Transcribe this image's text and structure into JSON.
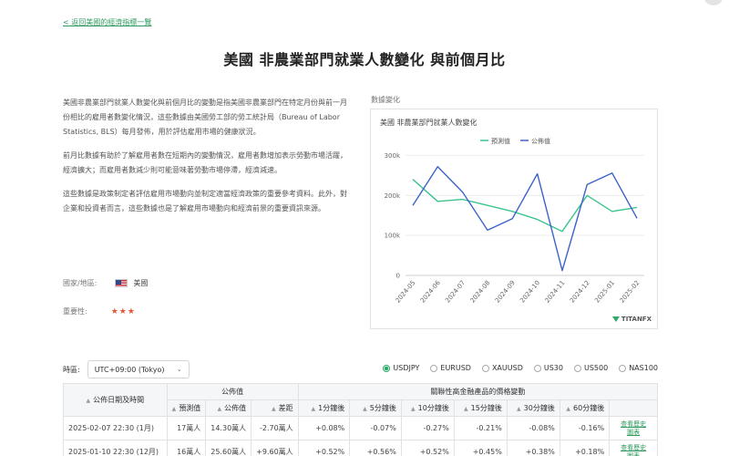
{
  "nav": {
    "back_link": "< 返回美國的經濟指標一覽"
  },
  "page": {
    "title": "美國 非農業部門就業人數變化 與前個月比"
  },
  "description": {
    "paragraphs": [
      "美國非農業部門就業人數變化與前個月比的變動是指美國非農業部門在特定月份與前一月份相比的雇用者數變化情況，這些數據由美國勞工部的勞工統計局（Bureau of Labor Statistics, BLS）每月發佈，用於評估雇用市場的健康狀況。",
      "前月比數據有助於了解雇用者數在短期內的變動情況，雇用者數增加表示勞動市場活躍，經濟擴大；而雇用者數減少則可能意味著勞動市場停滯，經濟減速。",
      "這些數據是政策制定者評估雇用市場動向並制定適當經濟政策的重要參考資料。此外，對企業和投資者而言，這些數據也是了解雇用市場動向和經濟前景的重要資訊來源。"
    ]
  },
  "meta": {
    "country_label": "國家/地區:",
    "country_value": "美國",
    "importance_label": "重要性:",
    "importance_stars": "★★★"
  },
  "chart_section": {
    "caption": "數據變化",
    "logo_text": "TITANFX"
  },
  "chart_data": {
    "type": "line",
    "title": "美國 非農業部門就業人數變化",
    "x": [
      "2024-05",
      "2024-06",
      "2024-07",
      "2024-08",
      "2024-09",
      "2024-10",
      "2024-11",
      "2024-12",
      "2025-01",
      "2025-02"
    ],
    "series": [
      {
        "name": "預測值",
        "color": "#3cc48e",
        "values": [
          240000,
          185000,
          190000,
          175000,
          160000,
          140000,
          110000,
          200000,
          160000,
          170000
        ]
      },
      {
        "name": "公佈值",
        "color": "#3b63c9",
        "values": [
          175000,
          272000,
          208000,
          113000,
          142000,
          254000,
          12000,
          227000,
          256000,
          143000
        ]
      }
    ],
    "yticks": [
      0,
      100000,
      200000,
      300000
    ],
    "ytick_labels": [
      "0",
      "100k",
      "200k",
      "300k"
    ],
    "ylim": [
      0,
      310000
    ],
    "legend": "top-center",
    "grid": true
  },
  "controls": {
    "tz_label": "時區:",
    "tz_value": "UTC+09:00 (Tokyo)",
    "symbols": [
      {
        "label": "USDJPY",
        "selected": true
      },
      {
        "label": "EURUSD",
        "selected": false
      },
      {
        "label": "XAUUSD",
        "selected": false
      },
      {
        "label": "US30",
        "selected": false
      },
      {
        "label": "US500",
        "selected": false
      },
      {
        "label": "NAS100",
        "selected": false
      }
    ]
  },
  "table": {
    "group_announced": "公佈值",
    "group_related": "關聯性高金融產品的價格變動",
    "col_datetime": "公佈日期及時間",
    "sub_headers": [
      "預測值",
      "公佈值",
      "差距",
      "1分鐘後",
      "5分鐘後",
      "10分鐘後",
      "15分鐘後",
      "30分鐘後",
      "60分鐘後"
    ],
    "rows": [
      {
        "datetime": "2025-02-07 22:30 (1月)",
        "forecast": "17萬人",
        "actual": "14.30萬人",
        "diff": "-2.70萬人",
        "m1": "+0.08%",
        "m5": "-0.07%",
        "m10": "-0.27%",
        "m15": "-0.21%",
        "m30": "-0.08%",
        "m60": "-0.16%",
        "link": "查看歷史圖表"
      },
      {
        "datetime": "2025-01-10 22:30 (12月)",
        "forecast": "16萬人",
        "actual": "25.60萬人",
        "diff": "+9.60萬人",
        "m1": "+0.52%",
        "m5": "+0.56%",
        "m10": "+0.52%",
        "m15": "+0.45%",
        "m30": "+0.38%",
        "m60": "+0.18%",
        "link": "查看歷史圖表"
      }
    ]
  }
}
